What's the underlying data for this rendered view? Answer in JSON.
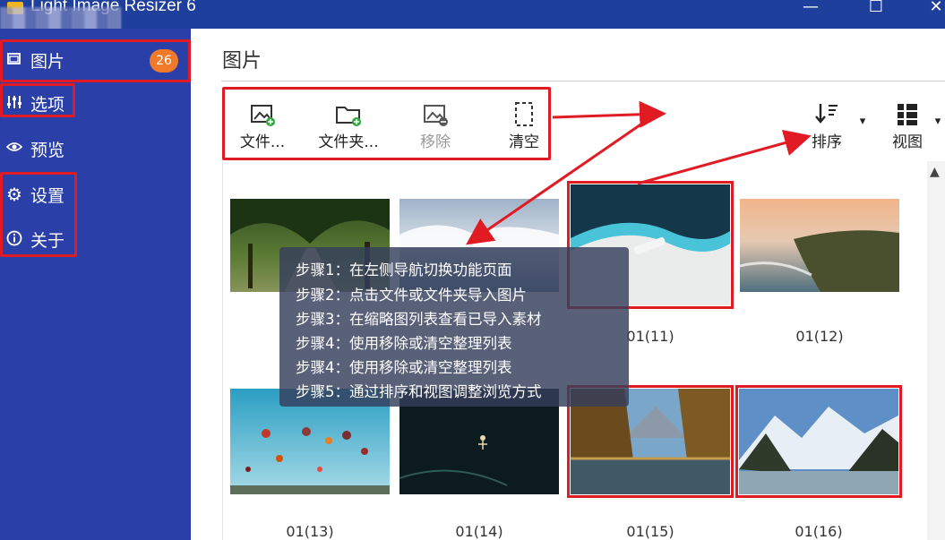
{
  "window": {
    "title": "Light Image Resizer 6",
    "minimize_glyph": "—",
    "maximize_glyph": "☐",
    "close_glyph": "✕"
  },
  "sidebar": {
    "items": [
      {
        "label": "图片",
        "icon": "image-icon",
        "badge": "26"
      },
      {
        "label": "选项",
        "icon": "sliders-icon"
      },
      {
        "label": "预览",
        "icon": "eye-icon"
      },
      {
        "label": "设置",
        "icon": "gear-icon"
      },
      {
        "label": "关于",
        "icon": "info-icon"
      }
    ]
  },
  "main": {
    "title": "图片",
    "toolbar": {
      "file": "文件...",
      "folder": "文件夹...",
      "remove": "移除",
      "clear": "清空",
      "sort": "排序",
      "view": "视图"
    }
  },
  "thumbnails": [
    {
      "caption": "",
      "selected": false,
      "scene": "tree-avenue"
    },
    {
      "caption": "",
      "selected": false,
      "scene": "cloud-sea"
    },
    {
      "caption": "01(11)",
      "selected": true,
      "scene": "aerial-beach-boat"
    },
    {
      "caption": "01(12)",
      "selected": false,
      "scene": "coast-sunset"
    },
    {
      "caption": "01(13)",
      "selected": false,
      "scene": "hot-air-balloons"
    },
    {
      "caption": "01(14)",
      "selected": false,
      "scene": "night-swimmer"
    },
    {
      "caption": "01(15)",
      "selected": true,
      "scene": "autumn-lake-mountains"
    },
    {
      "caption": "01(16)",
      "selected": true,
      "scene": "snowy-mountains-lake"
    }
  ],
  "overlay": {
    "steps": [
      "步骤1：在左侧导航切换功能页面",
      "步骤2：点击文件或文件夹导入图片",
      "步骤3：在缩略图列表查看已导入素材",
      "步骤4：使用移除或清空整理列表",
      "步骤4：使用移除或清空整理列表",
      "步骤5：通过排序和视图调整浏览方式"
    ]
  },
  "colors": {
    "sidebar": "#2a3fa8",
    "titlebar": "#1f3f9c",
    "highlight": "#e01b24",
    "badge": "#f07a2a"
  }
}
